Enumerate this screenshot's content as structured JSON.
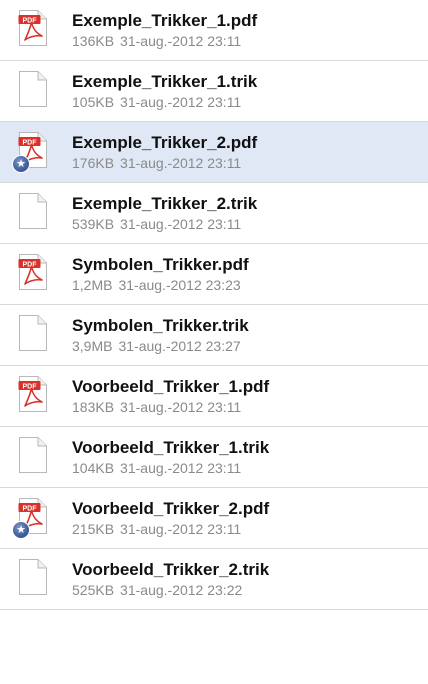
{
  "files": [
    {
      "name": "Exemple_Trikker_1.pdf",
      "size": "136KB",
      "date": "31-aug.-2012 23:11",
      "icon": "pdf-file-icon",
      "favorite": false,
      "selected": false
    },
    {
      "name": "Exemple_Trikker_1.trik",
      "size": "105KB",
      "date": "31-aug.-2012 23:11",
      "icon": "blank-file-icon",
      "favorite": false,
      "selected": false
    },
    {
      "name": "Exemple_Trikker_2.pdf",
      "size": "176KB",
      "date": "31-aug.-2012 23:11",
      "icon": "pdf-file-icon",
      "favorite": true,
      "selected": true
    },
    {
      "name": "Exemple_Trikker_2.trik",
      "size": "539KB",
      "date": "31-aug.-2012 23:11",
      "icon": "blank-file-icon",
      "favorite": false,
      "selected": false
    },
    {
      "name": "Symbolen_Trikker.pdf",
      "size": "1,2MB",
      "date": "31-aug.-2012 23:23",
      "icon": "pdf-file-icon",
      "favorite": false,
      "selected": false
    },
    {
      "name": "Symbolen_Trikker.trik",
      "size": "3,9MB",
      "date": "31-aug.-2012 23:27",
      "icon": "blank-file-icon",
      "favorite": false,
      "selected": false
    },
    {
      "name": "Voorbeeld_Trikker_1.pdf",
      "size": "183KB",
      "date": "31-aug.-2012 23:11",
      "icon": "pdf-file-icon",
      "favorite": false,
      "selected": false
    },
    {
      "name": "Voorbeeld_Trikker_1.trik",
      "size": "104KB",
      "date": "31-aug.-2012 23:11",
      "icon": "blank-file-icon",
      "favorite": false,
      "selected": false
    },
    {
      "name": "Voorbeeld_Trikker_2.pdf",
      "size": "215KB",
      "date": "31-aug.-2012 23:11",
      "icon": "pdf-file-icon",
      "favorite": true,
      "selected": false
    },
    {
      "name": "Voorbeeld_Trikker_2.trik",
      "size": "525KB",
      "date": "31-aug.-2012 23:22",
      "icon": "blank-file-icon",
      "favorite": false,
      "selected": false
    }
  ],
  "pdf_icon_label": "PDF",
  "colors": {
    "selected_row": "#dfe8f4",
    "pdf_badge": "#d8322a",
    "favorite_badge": "#3f5e9c",
    "meta_text": "#8a8a8a"
  }
}
